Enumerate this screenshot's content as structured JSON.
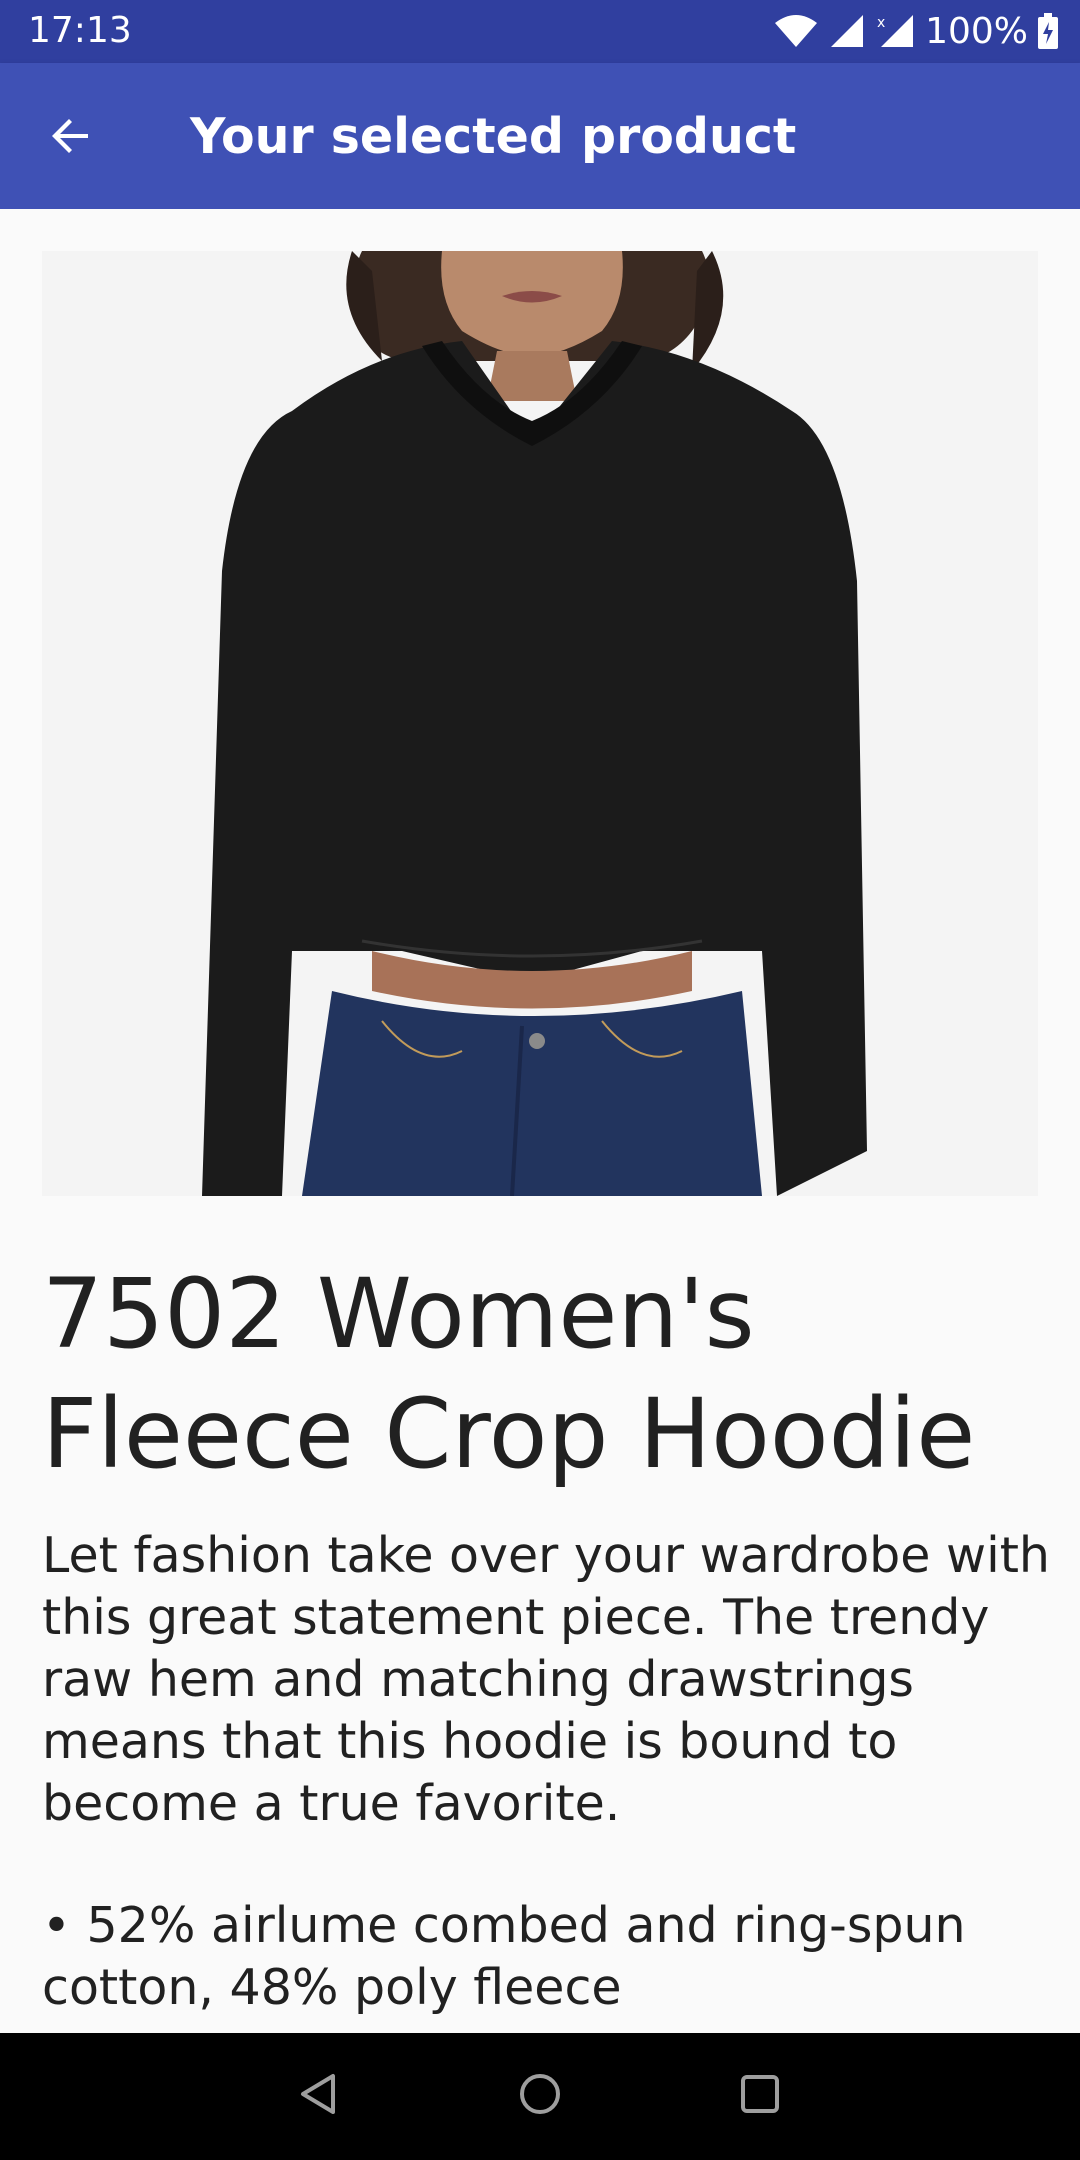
{
  "status_bar": {
    "time": "17:13",
    "battery": "100%",
    "icons": [
      "wifi-icon",
      "signal-icon",
      "signal-x-icon",
      "battery-icon"
    ]
  },
  "app_bar": {
    "back_icon": "arrow-left-icon",
    "title": "Your selected product",
    "color": "#3f51b5",
    "status_color": "#303f9f"
  },
  "product": {
    "image_label": "product-photo",
    "name": "7502 Women's Fleece Crop Hoodie",
    "description": "Let fashion take over your wardrobe with this great statement piece. The trendy raw hem and matching drawstrings means that this hoodie is bound to become a true favorite.",
    "bullet": "• 52% airlume combed and ring-spun cotton, 48% poly fleece"
  },
  "nav_bar": {
    "icons": [
      "back-triangle-icon",
      "home-circle-icon",
      "recents-square-icon"
    ]
  }
}
